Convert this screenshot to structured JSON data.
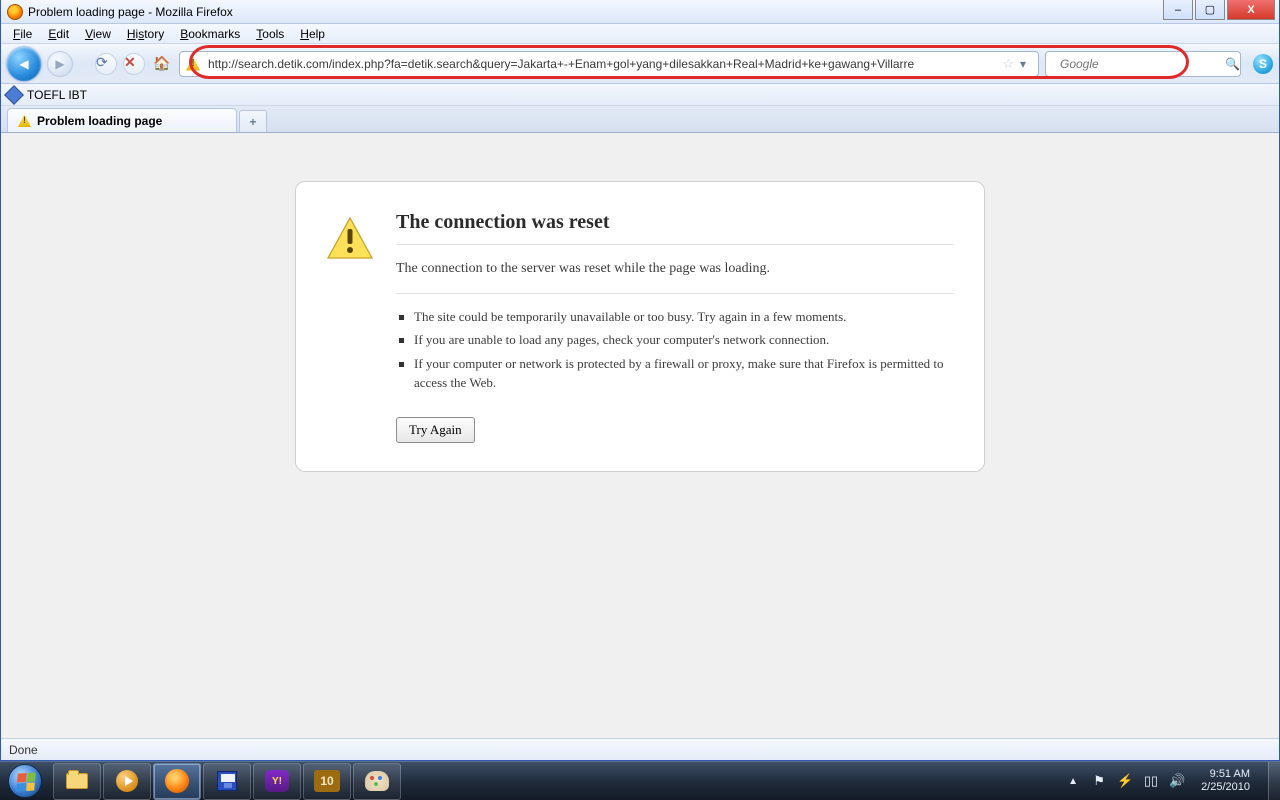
{
  "window": {
    "title": "Problem loading page - Mozilla Firefox",
    "controls": {
      "min": "–",
      "max": "▢",
      "close": "X"
    }
  },
  "menubar": {
    "file": "File",
    "edit": "Edit",
    "view": "View",
    "history": "History",
    "bookmarks": "Bookmarks",
    "tools": "Tools",
    "help": "Help"
  },
  "nav": {
    "url": "http://search.detik.com/index.php?fa=detik.search&query=Jakarta+-+Enam+gol+yang+dilesakkan+Real+Madrid+ke+gawang+Villarre",
    "search_placeholder": "Google",
    "back_glyph": "◀",
    "fwd_glyph": "▶",
    "reload_glyph": "⟳",
    "stop_glyph": "✕",
    "home_glyph": "🏠",
    "star_glyph": "☆",
    "dd_glyph": "▾",
    "mag_glyph": "🔍",
    "skype_glyph": "S"
  },
  "bookmarks": {
    "toefl": "TOEFL IBT"
  },
  "tabs": {
    "active": "Problem loading page",
    "new_glyph": "+"
  },
  "error": {
    "heading": "The connection was reset",
    "desc": "The connection to the server was reset while the page was loading.",
    "bullets": [
      "The site could be temporarily unavailable or too busy. Try again in a few moments.",
      "If you are unable to load any pages, check your computer's network connection.",
      "If your computer or network is protected by a firewall or proxy, make sure that Firefox is permitted to access the Web."
    ],
    "try_again": "Try Again"
  },
  "statusbar": {
    "left": "Done"
  },
  "taskbar": {
    "yahoo_label": "Y!",
    "game_label": "10",
    "tray": {
      "up": "▲",
      "flag": "⚑",
      "power": "⚡",
      "net": "▯▯",
      "vol": "🔊"
    },
    "clock": {
      "time": "9:51 AM",
      "date": "2/25/2010"
    }
  }
}
